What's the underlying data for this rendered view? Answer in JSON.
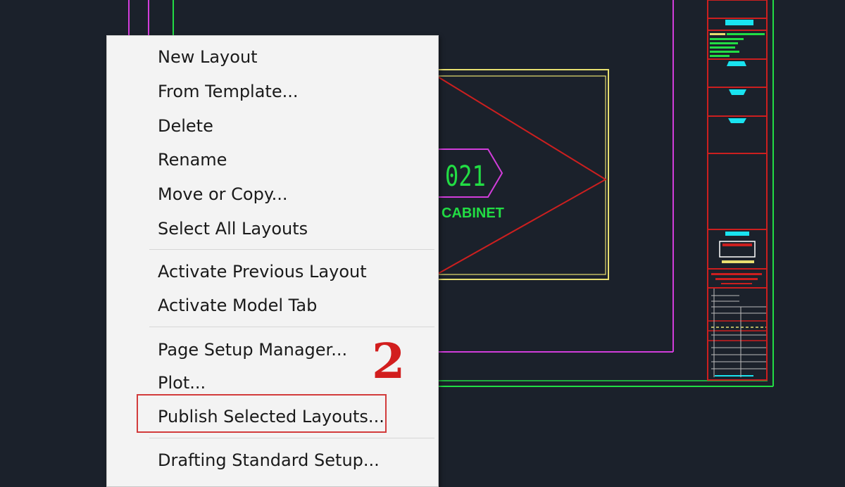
{
  "drawing": {
    "tag_number": "021",
    "label": "CABINET"
  },
  "menu": {
    "items": [
      {
        "label": "New Layout"
      },
      {
        "label": "From Template..."
      },
      {
        "label": "Delete"
      },
      {
        "label": "Rename"
      },
      {
        "label": "Move or Copy..."
      },
      {
        "label": "Select All Layouts"
      },
      {
        "label": "Activate Previous Layout"
      },
      {
        "label": "Activate Model Tab"
      },
      {
        "label": "Page Setup Manager..."
      },
      {
        "label": "Plot..."
      },
      {
        "label": "Publish Selected Layouts..."
      },
      {
        "label": "Drafting Standard Setup..."
      }
    ]
  },
  "annotation": {
    "step_number": "2"
  },
  "colors": {
    "background": "#1b212b",
    "highlight": "#d23b3b",
    "cad_green": "#22dd44",
    "cad_magenta": "#d23ddb",
    "cad_yellow": "#e8e070",
    "cad_red": "#cc1f1f",
    "cad_cyan": "#19e3f0"
  }
}
